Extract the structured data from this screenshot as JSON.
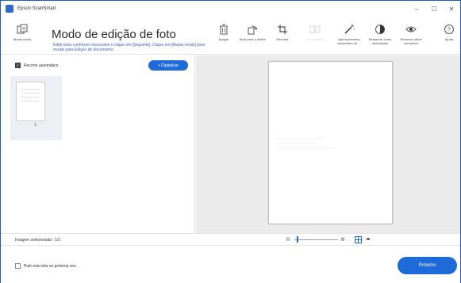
{
  "window": {
    "title": "Epson ScanSmart",
    "controls": {
      "minimize": "–",
      "maximize": "☐",
      "close": "✕"
    }
  },
  "toolbar": {
    "change_mode": "Mudar modo",
    "mode_title": "Modo de edição de foto",
    "mode_description": "Edite fotos conforme necessário e clique em [Seguinte]. Clique em [Mudar modo] para mudar para Edição de documento.",
    "tools": {
      "delete": "Apagar",
      "rotate_right": "Girar para a direita",
      "crop": "Recortar",
      "merge_images": "Unir imagens",
      "auto_enhance": "Aprimoramento automático de ...",
      "restore_faded": "Restaurar cores desbotadas",
      "remove_red_eye": "Remover olhos vermelhos",
      "help": "Ajuda"
    }
  },
  "left_panel": {
    "auto_crop_label": "Recorte automático",
    "auto_crop_checked": true,
    "scan_button": "+ Digitalizar",
    "thumbnail_number": "1"
  },
  "status": {
    "selected_images": "Imagem selecionada : 1/1",
    "zoom_out_icon": "zoom-out-icon",
    "zoom_in_icon": "zoom-in-icon",
    "zoom_level": 0.05
  },
  "bottom": {
    "skip_label": "Pule esta tela na próxima vez.",
    "skip_checked": false,
    "next_button": "Próximo"
  },
  "colors": {
    "accent": "#1e6ad9",
    "link_text": "#3a63b8",
    "preview_background": "#ebebeb",
    "window_border": "#1e5fb3"
  }
}
